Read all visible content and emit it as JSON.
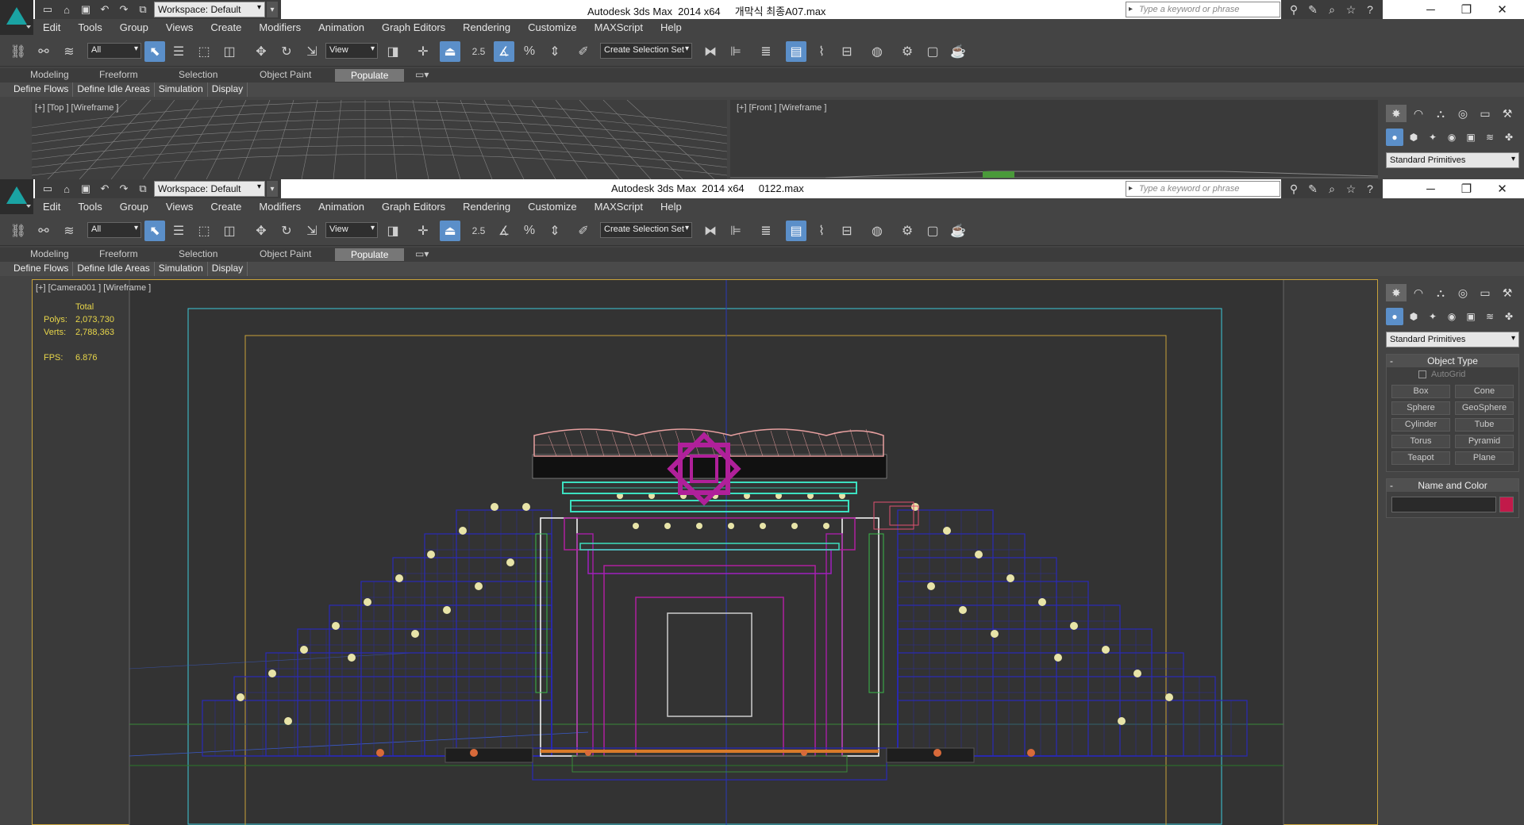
{
  "shared": {
    "workspace": "Workspace: Default",
    "search_placeholder": "Type a keyword or phrase",
    "menu": [
      "Edit",
      "Tools",
      "Group",
      "Views",
      "Create",
      "Modifiers",
      "Animation",
      "Graph Editors",
      "Rendering",
      "Customize",
      "MAXScript",
      "Help"
    ],
    "selection_filter": "All",
    "ref_coord": "View",
    "spinner_snap": "2.5",
    "named_selection_placeholder": "Create Selection Set",
    "ribbon_tabs": [
      "Modeling",
      "Freeform",
      "Selection",
      "Object Paint",
      "Populate"
    ],
    "ribbon_active": "Populate",
    "sub_tabs": [
      "Define Flows",
      "Define Idle Areas",
      "Simulation",
      "Display"
    ],
    "primitives_dropdown": "Standard Primitives"
  },
  "windowA": {
    "title": "Autodesk 3ds Max  2014 x64     개막식 최종A07.max",
    "viewport_top_label": "[+] [Top ] [Wireframe ]",
    "viewport_front_label": "[+] [Front ] [Wireframe ]"
  },
  "windowB": {
    "title": "Autodesk 3ds Max  2014 x64     0122.max",
    "viewport_label": "[+] [Camera001 ] [Wireframe ]",
    "stats": {
      "header": "Total",
      "polys_label": "Polys:",
      "polys": "2,073,730",
      "verts_label": "Verts:",
      "verts": "2,788,363",
      "fps_label": "FPS:",
      "fps": "6.876"
    },
    "command_panel": {
      "object_type_title": "Object Type",
      "autogrid_label": "AutoGrid",
      "buttons": [
        "Box",
        "Cone",
        "Sphere",
        "GeoSphere",
        "Cylinder",
        "Tube",
        "Torus",
        "Pyramid",
        "Teapot",
        "Plane"
      ],
      "name_color_title": "Name and Color",
      "object_color": "#c21a4a"
    }
  },
  "colors": {
    "accent_active": "#5b8fc9",
    "safe_frame_outer": "#c8a23a",
    "safe_frame_cyan": "#3cc8d8",
    "wire_blue": "#2a2ab8",
    "wire_magenta": "#b0209a",
    "wire_pink": "#e8a0a0"
  }
}
